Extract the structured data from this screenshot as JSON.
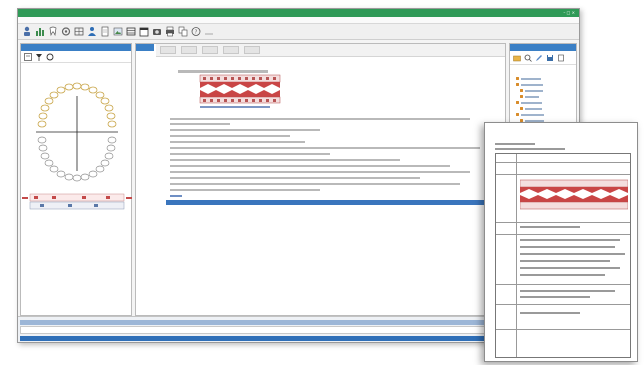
{
  "app": {
    "title": "",
    "menu": [
      "",
      "",
      "",
      "",
      "",
      "",
      ""
    ],
    "window_controls": "– □ ×",
    "accent_color": "#2f9a57",
    "header_color": "#3a7fc5"
  },
  "toolbar": {
    "icons": [
      "person-icon",
      "chart-icon",
      "tooth-icon",
      "settings-icon",
      "grid-icon",
      "user-icon",
      "document-icon",
      "image-icon",
      "table-icon",
      "calendar-icon",
      "camera-icon",
      "print-icon",
      "copy-icon",
      "help-icon",
      "note-icon"
    ]
  },
  "left_pane": {
    "header": "",
    "tools": [
      "filter-icon",
      "flag-icon",
      "rotate-icon"
    ]
  },
  "mid_pane": {
    "header": "",
    "tabs": [
      "",
      "",
      "",
      "",
      ""
    ],
    "dates": [
      "",
      "",
      "",
      "",
      "",
      "",
      "",
      "",
      "",
      "",
      "",
      ""
    ]
  },
  "right_pane": {
    "header": "",
    "tree_count": 12
  },
  "status": {
    "cells": [
      "",
      "",
      "",
      ""
    ]
  },
  "document": {
    "title": "",
    "section_labels": [
      "",
      "",
      "",
      "",
      ""
    ]
  }
}
